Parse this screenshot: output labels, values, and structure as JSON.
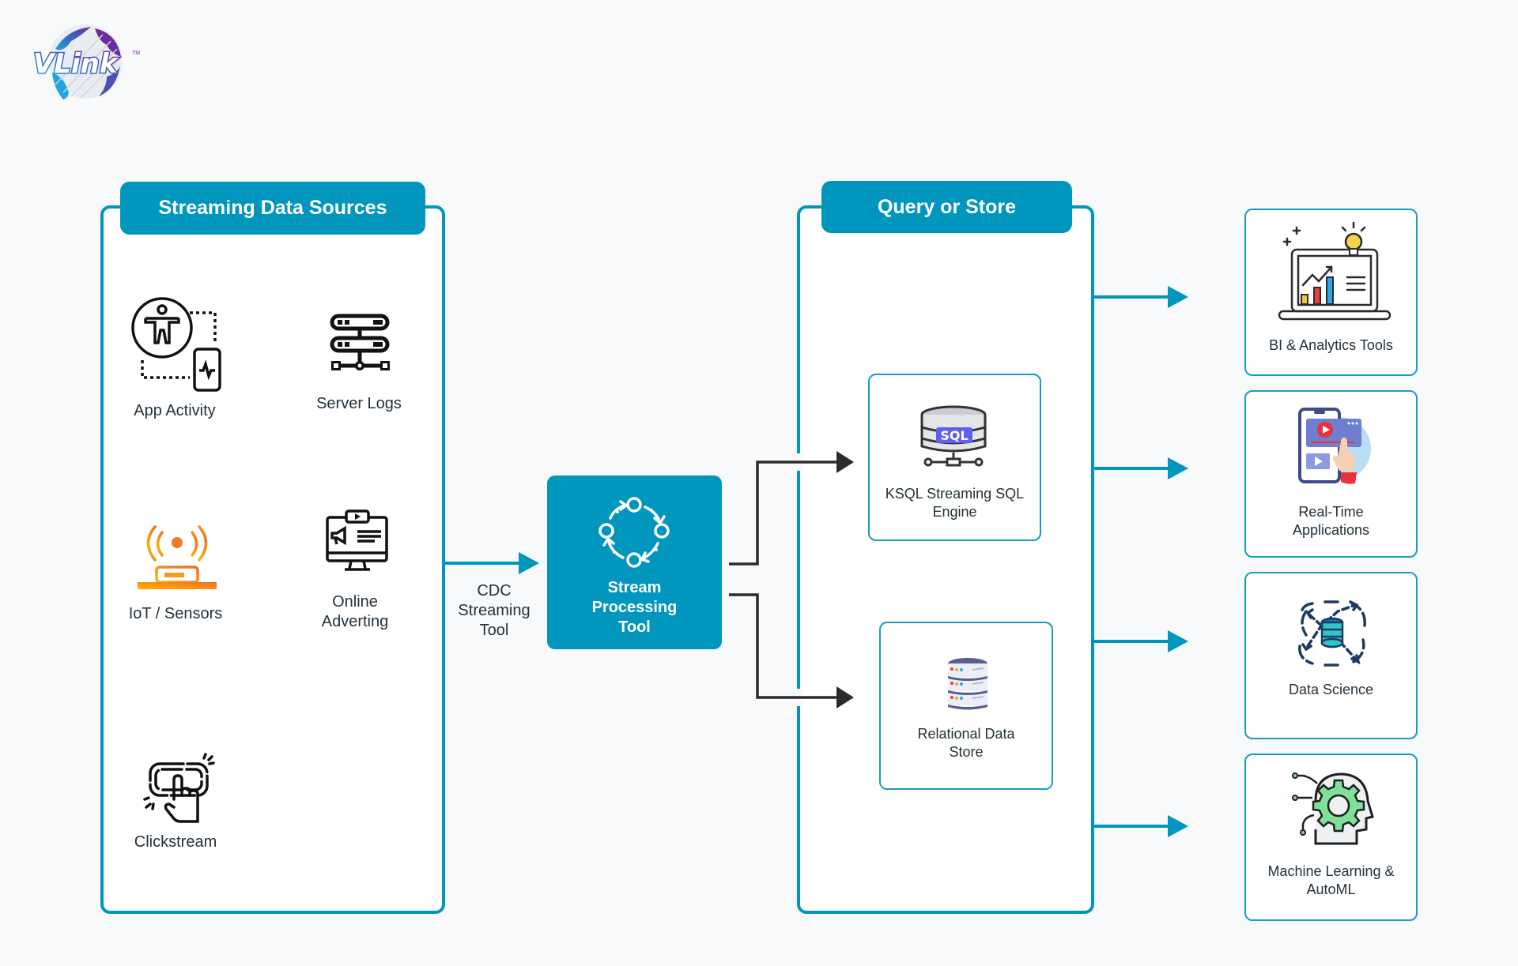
{
  "logo": {
    "text": "VLink",
    "trademark": "TM"
  },
  "colors": {
    "accent": "#0096be",
    "text": "#24313a",
    "connector": "#2b2b2b",
    "background": "#f8f9fa"
  },
  "sources_panel": {
    "title": "Streaming Data Sources",
    "items": [
      {
        "label": "App Activity",
        "icon": "app-activity-icon"
      },
      {
        "label": "Server Logs",
        "icon": "server-logs-icon"
      },
      {
        "label": "IoT / Sensors",
        "icon": "iot-sensor-icon"
      },
      {
        "label_line1": "Online",
        "label_line2": "Adverting",
        "icon": "online-advertising-icon"
      },
      {
        "label": "Clickstream",
        "icon": "clickstream-icon"
      }
    ]
  },
  "cdc": {
    "line1": "CDC",
    "line2": "Streaming",
    "line3": "Tool"
  },
  "stream_processing": {
    "line1": "Stream",
    "line2": "Processing",
    "line3": "Tool",
    "icon": "cycle-icon"
  },
  "query_panel": {
    "title": "Query or Store",
    "items": [
      {
        "line1": "KSQL Streaming SQL",
        "line2": "Engine",
        "icon": "sql-database-icon"
      },
      {
        "line1": "Relational Data",
        "line2": "Store",
        "icon": "database-icon"
      }
    ]
  },
  "destinations": [
    {
      "line1": "BI & Analytics Tools",
      "line2": "",
      "icon": "analytics-laptop-icon"
    },
    {
      "line1": "Real-Time",
      "line2": "Applications",
      "icon": "mobile-app-icon"
    },
    {
      "line1": "Data Science",
      "line2": "",
      "icon": "data-science-icon"
    },
    {
      "line1": "Machine Learning &",
      "line2": "AutoML",
      "icon": "ml-brain-gear-icon"
    }
  ]
}
